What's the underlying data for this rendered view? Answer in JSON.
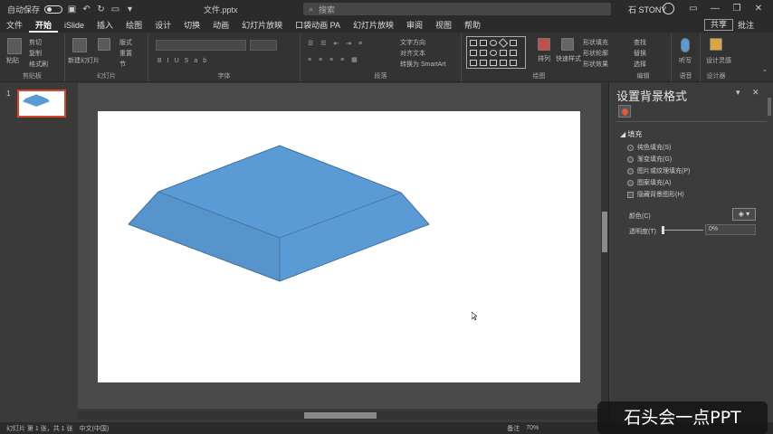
{
  "titlebar": {
    "autosave_label": "自动保存",
    "doc_title": "文件.pptx",
    "search_placeholder": "搜索",
    "user_name": "石 STONY",
    "minimize": "—",
    "restore": "❐",
    "close": "✕"
  },
  "tabs": [
    {
      "label": "文件"
    },
    {
      "label": "开始"
    },
    {
      "label": "iSlide"
    },
    {
      "label": "插入"
    },
    {
      "label": "绘图"
    },
    {
      "label": "设计"
    },
    {
      "label": "切换"
    },
    {
      "label": "动画"
    },
    {
      "label": "幻灯片放映"
    },
    {
      "label": "口袋动画 PA"
    },
    {
      "label": "幻灯片放映"
    },
    {
      "label": "审阅"
    },
    {
      "label": "视图"
    },
    {
      "label": "帮助"
    }
  ],
  "ribbon": {
    "share_label": "共享",
    "comment_label": "批注",
    "groups": {
      "clipboard": "剪贴板",
      "slides": "幻灯片",
      "font": "字体",
      "paragraph": "段落",
      "drawing": "绘图",
      "editing": "编辑",
      "voice": "语音",
      "designer": "设计器"
    },
    "buttons": {
      "paste": "粘贴",
      "cut": "剪切",
      "copy": "复制",
      "format_painter": "格式刷",
      "new_slide": "新建幻灯片",
      "layout": "版式",
      "reset": "重置",
      "section": "节",
      "text_direction": "文字方向",
      "align_text": "对齐文本",
      "smartart": "转换为 SmartArt",
      "arrange": "排列",
      "quick_styles": "快速样式",
      "shape_fill": "形状填充",
      "shape_outline": "形状轮廓",
      "shape_effects": "形状效果",
      "find": "查找",
      "replace": "替换",
      "select": "选择",
      "dictate": "听写",
      "design_ideas": "设计灵感"
    }
  },
  "thumbnails": {
    "slide_number": "1"
  },
  "format_pane": {
    "title": "设置背景格式",
    "section": "填充",
    "options": [
      {
        "label": "纯色填充(S)",
        "selected": true
      },
      {
        "label": "渐变填充(G)",
        "selected": false
      },
      {
        "label": "图片或纹理填充(P)",
        "selected": false
      },
      {
        "label": "图案填充(A)",
        "selected": false
      }
    ],
    "hide_bg_graphics": "隐藏背景图形(H)",
    "color_label": "颜色(C)",
    "transparency_label": "透明度(T)",
    "transparency_value": "0%",
    "transparency_fraction": 0,
    "fill_tab_icon": "paint-bucket-icon"
  },
  "slide": {
    "shape_color": "#5b9bd5",
    "shape_edge_color": "#41719c"
  },
  "statusbar": {
    "slide_info": "幻灯片 第 1 张，共 1 张",
    "language": "中文(中国)",
    "notes": "备注",
    "zoom": "70%"
  },
  "watermark": "石头会一点PPT"
}
